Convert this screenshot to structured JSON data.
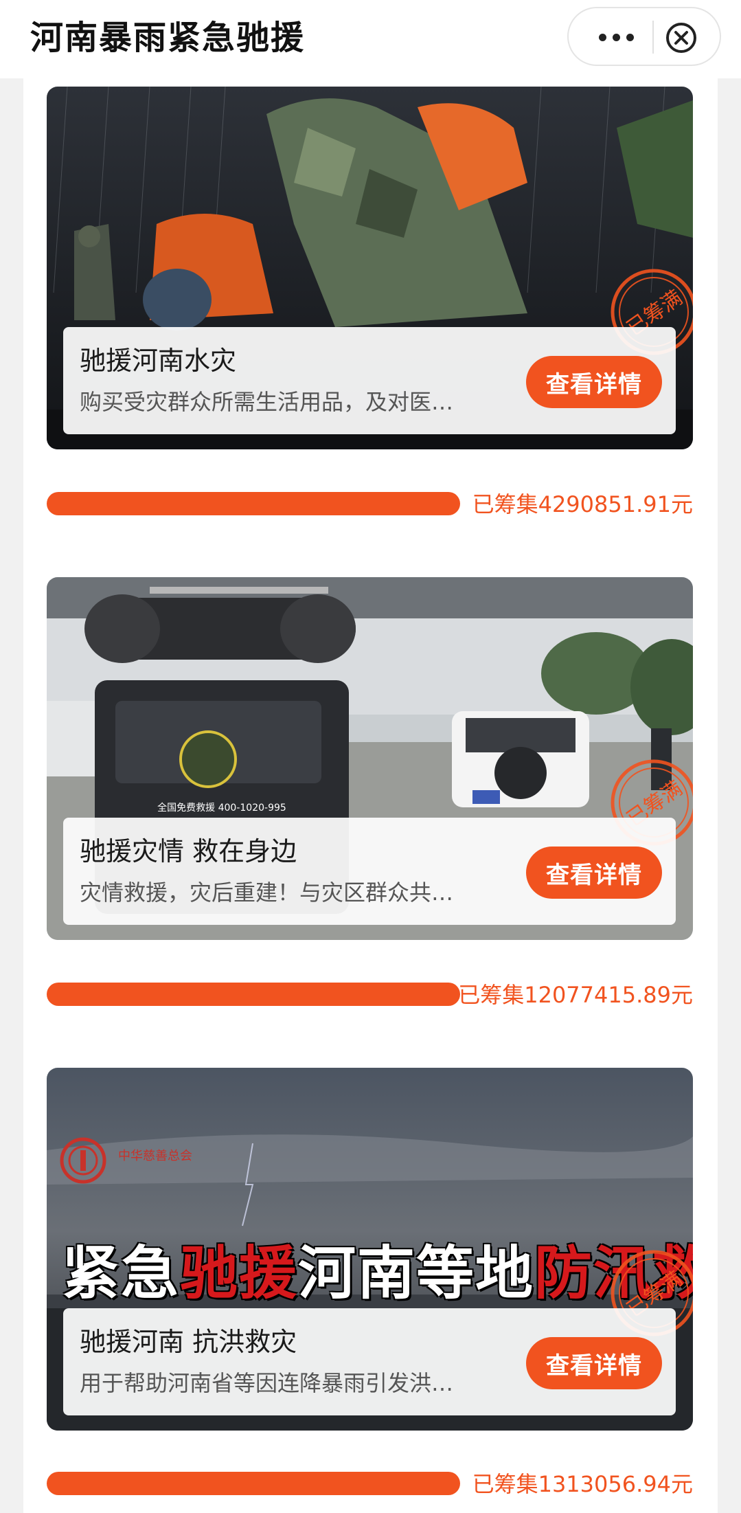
{
  "header": {
    "title": "河南暴雨紧急驰援"
  },
  "projects": [
    {
      "title": "驰援河南水灾",
      "description": "购买受灾群众所需生活用品，及对医…",
      "button": "查看详情",
      "stamp": "已筹满",
      "raised": "已筹集4290851.91元",
      "progress": 1.0
    },
    {
      "title": "驰援灾情 救在身边",
      "description": "灾情救援，灾后重建！与灾区群众共…",
      "button": "查看详情",
      "stamp": "已筹满",
      "raised": "已筹集12077415.89元",
      "progress": 1.0
    },
    {
      "title": "驰援河南 抗洪救灾",
      "description": "用于帮助河南省等因连降暴雨引发洪…",
      "button": "查看详情",
      "stamp": "已筹满",
      "raised": "已筹集1313056.94元",
      "progress": 1.0,
      "banner": {
        "org_name": "中华慈善总会",
        "slogan_1": "紧急",
        "slogan_2": "驰援",
        "slogan_3": "河南等地",
        "slogan_4": "防汛救灾"
      }
    }
  ],
  "van": {
    "hotline": "全国免费救援 400-1020-995"
  },
  "colors": {
    "accent": "#f1531f",
    "banner_red": "#d6191c"
  },
  "icons": {
    "more": "more-dots-icon",
    "close": "close-circle-icon"
  }
}
